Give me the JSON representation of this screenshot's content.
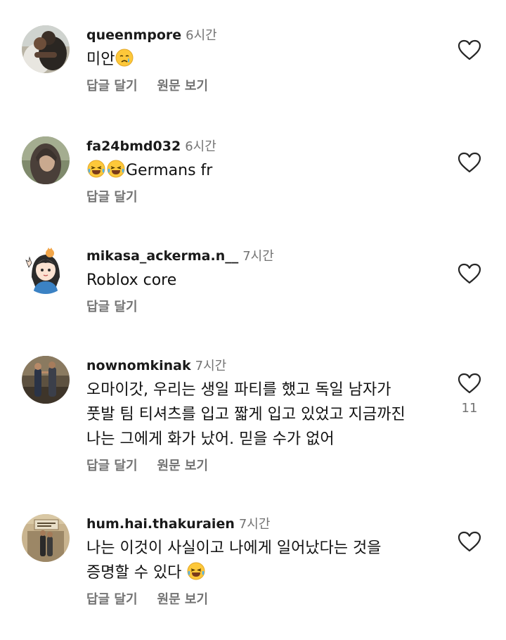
{
  "actions": {
    "reply": "답글 달기",
    "see_translation": "원문 보기"
  },
  "comments": [
    {
      "username": "queenmpore",
      "time": "6시간",
      "text": "미안",
      "emoji": "crying-face",
      "avatar": "hug-photo"
    },
    {
      "username": "fa24bmd032",
      "time": "6시간",
      "text": "Germans fr",
      "emoji": "laughing-face x2",
      "avatar": "hijab-photo"
    },
    {
      "username": "mikasa_ackerma.n__",
      "time": "7시간",
      "text": "Roblox core",
      "avatar": "anime-girl-drawing"
    },
    {
      "username": "nownomkinak",
      "time": "7시간",
      "text_lines": [
        "오마이갓, 우리는 생일 파티를 했고 독일 남자가",
        "풋발 팀 티셔츠를 입고 짧게 입고 있었고 지금까진",
        "나는 그에게 화가 났어. 믿을 수가 없어"
      ],
      "likes": "11",
      "avatar": "two-people-photo"
    },
    {
      "username": "hum.hai.thakuraien",
      "time": "7시간",
      "text_lines": [
        "나는 이것이 사실이고 나에게 일어났다는 것을",
        "증명할 수 있다"
      ],
      "emoji": "laughing-face",
      "avatar": "building-photo"
    }
  ],
  "icons": {
    "like": "heart-outline-icon"
  }
}
